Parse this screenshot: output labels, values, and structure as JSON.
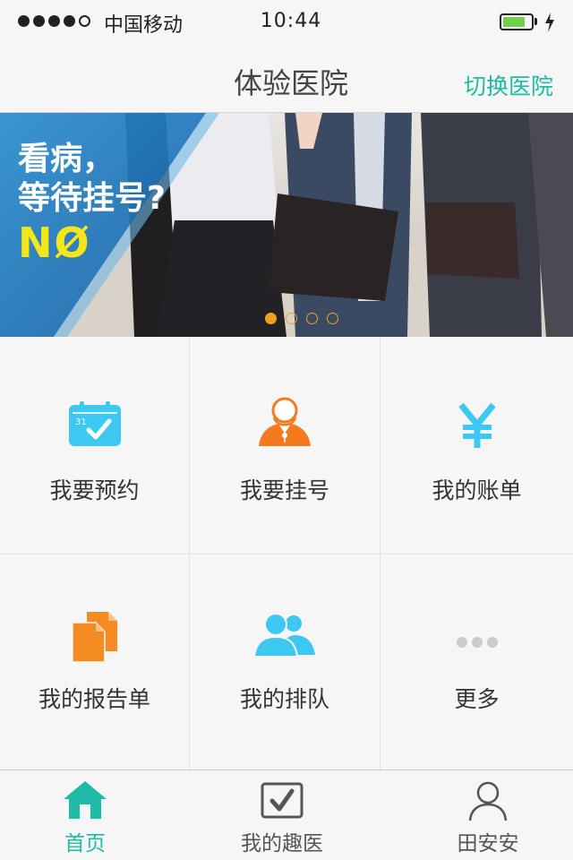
{
  "status_bar": {
    "carrier": "中国移动",
    "time": "10:44",
    "signal_bars_filled": 4,
    "signal_bars_total": 5,
    "battery_level": 0.7,
    "battery_color": "#6cd34a"
  },
  "nav": {
    "title": "体验医院",
    "switch_label": "切换医院",
    "accent_color": "#1ebba6"
  },
  "banner": {
    "line1": "看病，",
    "line2": "等待挂号?",
    "line3": "NØ",
    "page_count": 4,
    "active_page": 1
  },
  "grid": {
    "items": [
      {
        "label": "我要预约",
        "icon": "calendar-check-icon",
        "icon_color": "#3cc8f0"
      },
      {
        "label": "我要挂号",
        "icon": "doctor-icon",
        "icon_color": "#f47a1e"
      },
      {
        "label": "我的账单",
        "icon": "yen-icon",
        "icon_color": "#3cc8f0"
      },
      {
        "label": "我的报告单",
        "icon": "documents-icon",
        "icon_color": "#f48a22"
      },
      {
        "label": "我的排队",
        "icon": "people-icon",
        "icon_color": "#3cc8f0"
      },
      {
        "label": "更多",
        "icon": "more-dots-icon",
        "icon_color": "#cccccc"
      }
    ]
  },
  "tabbar": {
    "tabs": [
      {
        "label": "首页",
        "icon": "home-icon",
        "active": true
      },
      {
        "label": "我的趣医",
        "icon": "checkbox-icon",
        "active": false
      },
      {
        "label": "田安安",
        "icon": "user-icon",
        "active": false
      }
    ]
  }
}
